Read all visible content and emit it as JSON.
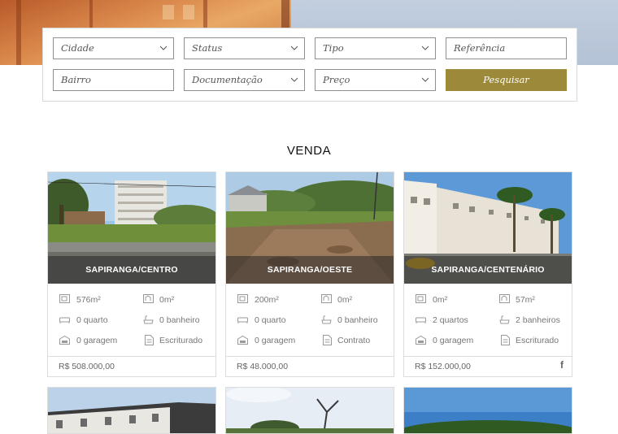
{
  "search": {
    "fields": {
      "cidade": "Cidade",
      "status": "Status",
      "tipo": "Tipo",
      "referencia": "Referência",
      "bairro": "Bairro",
      "documentacao": "Documentação",
      "preco": "Preço"
    },
    "button_label": "Pesquisar"
  },
  "section_title": "VENDA",
  "accent_color": "#9c8a3a",
  "listings": [
    {
      "caption": "SAPIRANGA/CENTRO",
      "area_total": "576m²",
      "area_built": "0m²",
      "bedrooms": "0 quarto",
      "bathrooms": "0 banheiro",
      "garage": "0 garagem",
      "document": "Escriturado",
      "price": "R$ 508.000,00"
    },
    {
      "caption": "SAPIRANGA/OESTE",
      "area_total": "200m²",
      "area_built": "0m²",
      "bedrooms": "0 quarto",
      "bathrooms": "0 banheiro",
      "garage": "0 garagem",
      "document": "Contrato",
      "price": "R$ 48.000,00"
    },
    {
      "caption": "SAPIRANGA/CENTENÁRIO",
      "area_total": "0m²",
      "area_built": "57m²",
      "bedrooms": "2 quartos",
      "bathrooms": "2 banheiros",
      "garage": "0 garagem",
      "document": "Escriturado",
      "price": "R$ 152.000,00",
      "share_icon": "facebook-icon",
      "share_label": "f"
    }
  ],
  "icons": [
    "chevron-down-icon",
    "area-total-icon",
    "area-built-icon",
    "bed-icon",
    "bath-icon",
    "garage-icon",
    "document-icon",
    "facebook-icon"
  ]
}
